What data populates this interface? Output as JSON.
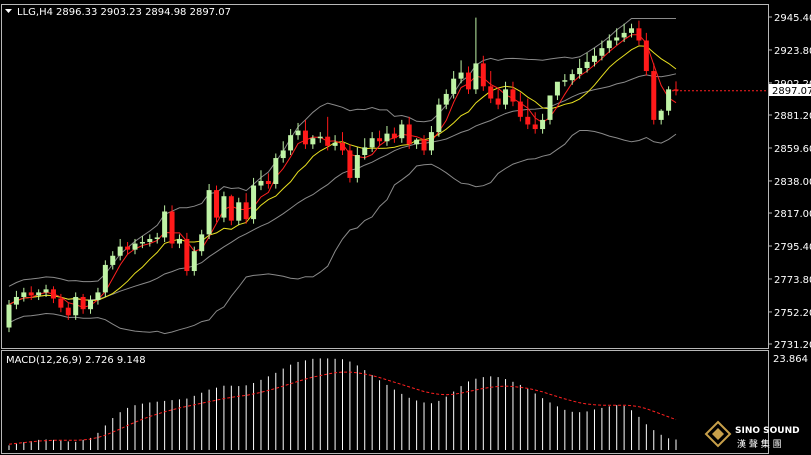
{
  "chart_data": [
    {
      "type": "candlestick",
      "symbol_label": "LLG,H4",
      "ohlc_header": [
        "2896.33",
        "2903.23",
        "2894.98",
        "2897.07"
      ],
      "current_price_label": "2897.07",
      "current_price": 2897.07,
      "y_ticks": [
        "2945.40",
        "2923.80",
        "2902.20",
        "2881.20",
        "2859.60",
        "2838.00",
        "2817.00",
        "2795.40",
        "2773.80",
        "2752.20",
        "2731.20"
      ],
      "ylim": [
        2731.2,
        2945.4
      ],
      "colors": {
        "bull": "#bff3a6",
        "bear": "#ff1a1a",
        "bands": "#8a8a8a",
        "ma_fast": "#ff2020",
        "ma_slow": "#e8e020"
      },
      "candles": [
        {
          "o": 2742,
          "h": 2760,
          "c": 2757
        },
        {
          "o": 2757,
          "h": 2766,
          "c": 2762
        },
        {
          "o": 2762,
          "h": 2768,
          "c": 2765
        },
        {
          "o": 2765,
          "h": 2769,
          "c": 2763
        },
        {
          "o": 2763,
          "h": 2767,
          "c": 2765
        },
        {
          "o": 2765,
          "h": 2770,
          "c": 2767
        },
        {
          "o": 2767,
          "h": 2769,
          "c": 2761
        },
        {
          "o": 2761,
          "h": 2764,
          "c": 2755
        },
        {
          "o": 2755,
          "h": 2758,
          "c": 2750
        },
        {
          "o": 2750,
          "h": 2765,
          "c": 2762
        },
        {
          "o": 2762,
          "h": 2764,
          "c": 2754
        },
        {
          "o": 2754,
          "h": 2763,
          "c": 2760
        },
        {
          "o": 2760,
          "h": 2768,
          "c": 2765
        },
        {
          "o": 2765,
          "h": 2786,
          "c": 2783
        },
        {
          "o": 2783,
          "h": 2792,
          "c": 2789
        },
        {
          "o": 2789,
          "h": 2800,
          "c": 2795
        },
        {
          "o": 2795,
          "h": 2798,
          "c": 2793
        },
        {
          "o": 2793,
          "h": 2800,
          "c": 2797
        },
        {
          "o": 2797,
          "h": 2802,
          "c": 2798
        },
        {
          "o": 2798,
          "h": 2803,
          "c": 2800
        },
        {
          "o": 2800,
          "h": 2804,
          "c": 2801
        },
        {
          "o": 2801,
          "h": 2822,
          "c": 2818
        },
        {
          "o": 2818,
          "h": 2822,
          "c": 2797
        },
        {
          "o": 2797,
          "h": 2803,
          "c": 2800
        },
        {
          "o": 2800,
          "h": 2804,
          "c": 2779
        },
        {
          "o": 2779,
          "h": 2795,
          "c": 2792
        },
        {
          "o": 2792,
          "h": 2806,
          "c": 2803
        },
        {
          "o": 2803,
          "h": 2836,
          "c": 2832
        },
        {
          "o": 2832,
          "h": 2835,
          "c": 2814
        },
        {
          "o": 2814,
          "h": 2831,
          "c": 2828
        },
        {
          "o": 2828,
          "h": 2829,
          "c": 2812
        },
        {
          "o": 2812,
          "h": 2827,
          "c": 2824
        },
        {
          "o": 2824,
          "h": 2830,
          "c": 2813
        },
        {
          "o": 2813,
          "h": 2840,
          "c": 2835
        },
        {
          "o": 2835,
          "h": 2845,
          "c": 2838
        },
        {
          "o": 2838,
          "h": 2843,
          "c": 2836
        },
        {
          "o": 2836,
          "h": 2856,
          "c": 2853
        },
        {
          "o": 2853,
          "h": 2864,
          "c": 2858
        },
        {
          "o": 2858,
          "h": 2872,
          "c": 2868
        },
        {
          "o": 2868,
          "h": 2876,
          "c": 2871
        },
        {
          "o": 2871,
          "h": 2878,
          "c": 2862
        },
        {
          "o": 2862,
          "h": 2868,
          "c": 2866
        },
        {
          "o": 2866,
          "h": 2870,
          "c": 2867
        },
        {
          "o": 2867,
          "h": 2880,
          "c": 2861
        },
        {
          "o": 2861,
          "h": 2868,
          "c": 2863
        },
        {
          "o": 2863,
          "h": 2870,
          "c": 2858
        },
        {
          "o": 2858,
          "h": 2862,
          "c": 2840
        },
        {
          "o": 2840,
          "h": 2860,
          "c": 2855
        },
        {
          "o": 2855,
          "h": 2866,
          "c": 2860
        },
        {
          "o": 2860,
          "h": 2870,
          "c": 2866
        },
        {
          "o": 2866,
          "h": 2871,
          "c": 2864
        },
        {
          "o": 2864,
          "h": 2874,
          "c": 2869
        },
        {
          "o": 2869,
          "h": 2873,
          "c": 2866
        },
        {
          "o": 2866,
          "h": 2878,
          "c": 2875
        },
        {
          "o": 2875,
          "h": 2880,
          "c": 2862
        },
        {
          "o": 2862,
          "h": 2866,
          "c": 2865
        },
        {
          "o": 2865,
          "h": 2868,
          "c": 2858
        },
        {
          "o": 2858,
          "h": 2874,
          "c": 2870
        },
        {
          "o": 2870,
          "h": 2892,
          "c": 2888
        },
        {
          "o": 2888,
          "h": 2898,
          "c": 2895
        },
        {
          "o": 2895,
          "h": 2910,
          "c": 2905
        },
        {
          "o": 2905,
          "h": 2917,
          "c": 2909
        },
        {
          "o": 2909,
          "h": 2913,
          "c": 2898
        },
        {
          "o": 2898,
          "h": 2945,
          "c": 2915
        },
        {
          "o": 2915,
          "h": 2920,
          "c": 2900
        },
        {
          "o": 2900,
          "h": 2910,
          "c": 2892
        },
        {
          "o": 2892,
          "h": 2898,
          "c": 2888
        },
        {
          "o": 2888,
          "h": 2903,
          "c": 2898
        },
        {
          "o": 2898,
          "h": 2903,
          "c": 2890
        },
        {
          "o": 2890,
          "h": 2896,
          "c": 2880
        },
        {
          "o": 2880,
          "h": 2892,
          "c": 2875
        },
        {
          "o": 2875,
          "h": 2883,
          "c": 2872
        },
        {
          "o": 2872,
          "h": 2882,
          "c": 2878
        },
        {
          "o": 2878,
          "h": 2884,
          "c": 2894
        },
        {
          "o": 2894,
          "h": 2902,
          "c": 2903
        },
        {
          "o": 2903,
          "h": 2908,
          "c": 2904
        },
        {
          "o": 2904,
          "h": 2911,
          "c": 2908
        },
        {
          "o": 2908,
          "h": 2918,
          "c": 2912
        },
        {
          "o": 2912,
          "h": 2922,
          "c": 2916
        },
        {
          "o": 2916,
          "h": 2925,
          "c": 2920
        },
        {
          "o": 2920,
          "h": 2930,
          "c": 2925
        },
        {
          "o": 2925,
          "h": 2934,
          "c": 2930
        },
        {
          "o": 2930,
          "h": 2938,
          "c": 2932
        },
        {
          "o": 2932,
          "h": 2941,
          "c": 2935
        },
        {
          "o": 2935,
          "h": 2941,
          "c": 2938
        },
        {
          "o": 2938,
          "h": 2943,
          "c": 2930
        },
        {
          "o": 2930,
          "h": 2935,
          "c": 2910
        },
        {
          "o": 2910,
          "h": 2915,
          "c": 2878
        },
        {
          "o": 2878,
          "h": 2885,
          "c": 2884
        },
        {
          "o": 2884,
          "h": 2900,
          "c": 2898
        },
        {
          "o": 2898,
          "h": 2903.23,
          "c": 2897.07
        }
      ],
      "macd_label": "MACD(12,26,9) 2.726 9.148",
      "macd_axis_label": "23.864",
      "macd_ylim": [
        0,
        23.864
      ],
      "macd_hist": [
        1.2,
        1.6,
        2.0,
        2.3,
        2.6,
        2.7,
        2.6,
        2.4,
        2.2,
        2.1,
        2.6,
        3.1,
        4.4,
        6.3,
        8.2,
        9.7,
        10.8,
        11.5,
        11.9,
        12.2,
        12.4,
        12.6,
        12.8,
        13.0,
        13.2,
        13.9,
        14.7,
        15.5,
        16.0,
        16.5,
        16.5,
        16.4,
        16.6,
        17.2,
        18.0,
        18.9,
        19.8,
        20.9,
        21.9,
        22.6,
        23.0,
        23.4,
        23.5,
        23.5,
        23.4,
        23.3,
        22.7,
        21.7,
        20.5,
        19.2,
        17.9,
        16.7,
        15.5,
        14.4,
        13.4,
        12.7,
        12.2,
        12.0,
        12.6,
        13.7,
        15.0,
        16.4,
        17.6,
        18.3,
        18.7,
        18.9,
        18.7,
        18.2,
        17.5,
        16.7,
        15.7,
        14.5,
        13.3,
        12.2,
        11.2,
        10.3,
        9.8,
        9.7,
        9.9,
        10.4,
        10.8,
        11.2,
        11.5,
        11.3,
        10.2,
        8.5,
        6.6,
        5.1,
        3.9,
        3.0,
        2.7
      ],
      "macd_signal": [
        1.5,
        1.7,
        1.9,
        2.1,
        2.3,
        2.4,
        2.5,
        2.5,
        2.5,
        2.5,
        2.6,
        2.8,
        3.2,
        3.8,
        4.6,
        5.4,
        6.3,
        7.1,
        7.9,
        8.6,
        9.2,
        9.8,
        10.3,
        10.8,
        11.2,
        11.6,
        12.0,
        12.4,
        12.8,
        13.2,
        13.5,
        13.8,
        14.0,
        14.4,
        14.8,
        15.3,
        15.8,
        16.4,
        17.0,
        17.6,
        18.2,
        18.7,
        19.1,
        19.5,
        19.8,
        20.0,
        20.0,
        19.8,
        19.5,
        19.1,
        18.6,
        18.0,
        17.4,
        16.8,
        16.2,
        15.6,
        15.0,
        14.6,
        14.3,
        14.2,
        14.3,
        14.6,
        15.0,
        15.4,
        15.8,
        16.1,
        16.3,
        16.4,
        16.3,
        16.1,
        15.8,
        15.4,
        14.9,
        14.3,
        13.7,
        13.1,
        12.6,
        12.1,
        11.8,
        11.6,
        11.5,
        11.5,
        11.5,
        11.5,
        11.4,
        11.1,
        10.6,
        9.9,
        9.2,
        8.5,
        7.8
      ]
    }
  ],
  "watermark": {
    "brand": "SINO SOUND",
    "chinese": "漢 聲 集 團",
    "logo_icon": "diamond-logo-icon"
  }
}
